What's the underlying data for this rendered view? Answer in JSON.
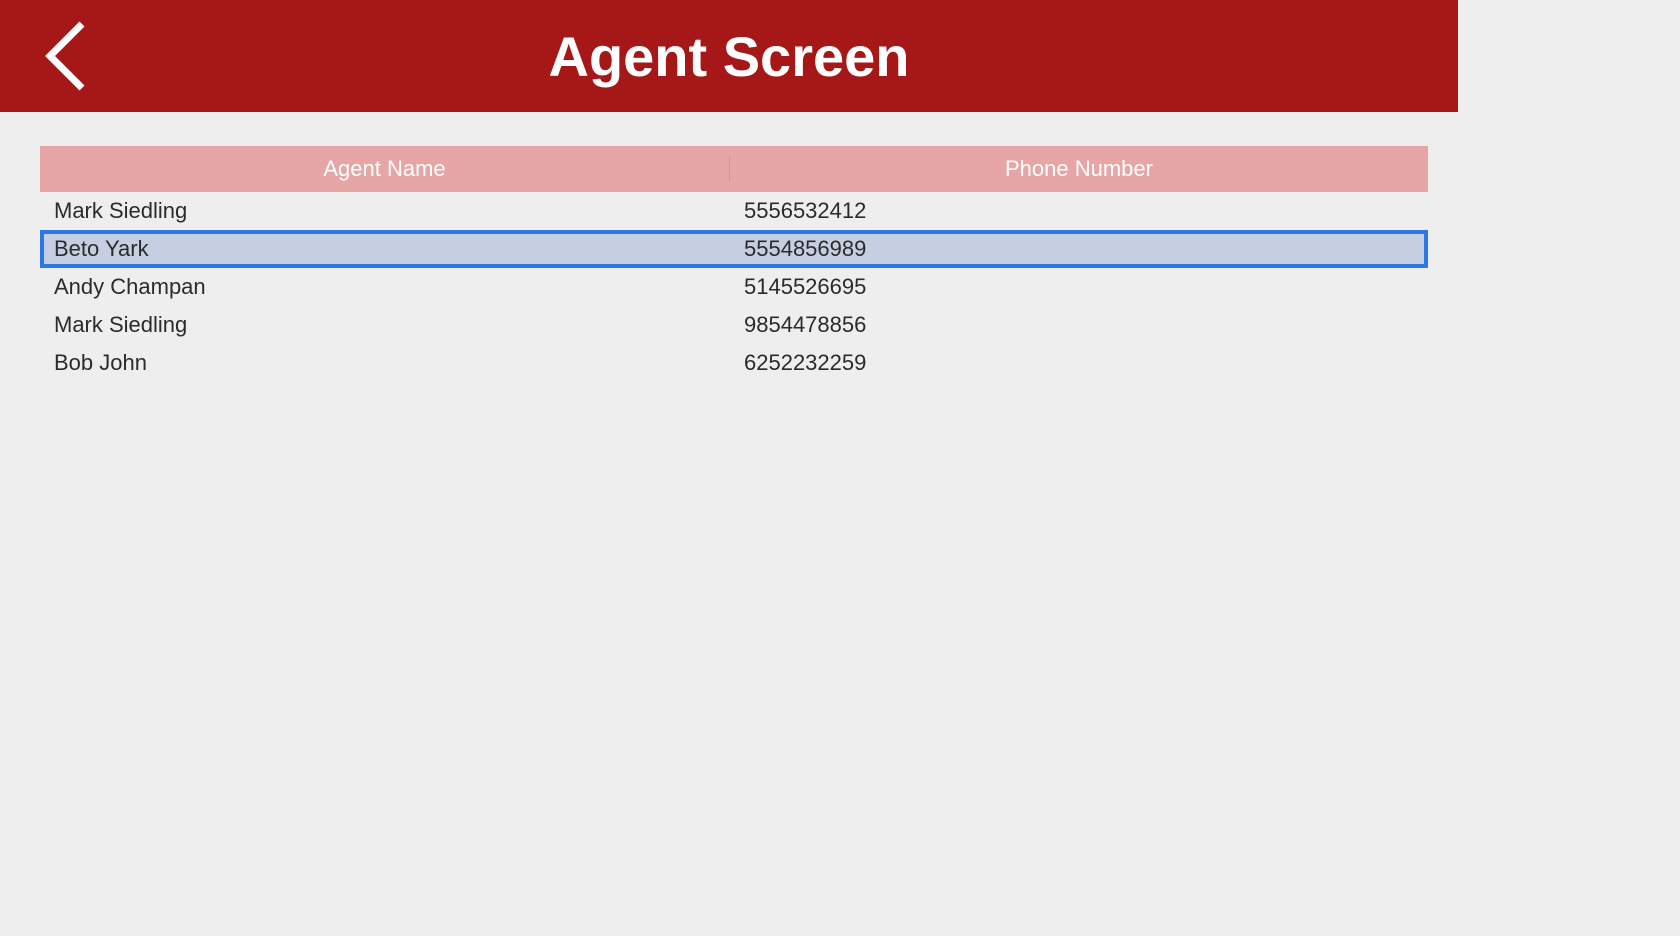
{
  "header": {
    "title": "Agent Screen"
  },
  "table": {
    "columns": {
      "name": "Agent Name",
      "phone": "Phone Number"
    },
    "selectedIndex": 1,
    "rows": [
      {
        "name": "Mark Siedling",
        "phone": "5556532412"
      },
      {
        "name": "Beto Yark",
        "phone": "5554856989"
      },
      {
        "name": "Andy Champan",
        "phone": "5145526695"
      },
      {
        "name": "Mark Siedling",
        "phone": "9854478856"
      },
      {
        "name": "Bob John",
        "phone": "6252232259"
      }
    ]
  }
}
